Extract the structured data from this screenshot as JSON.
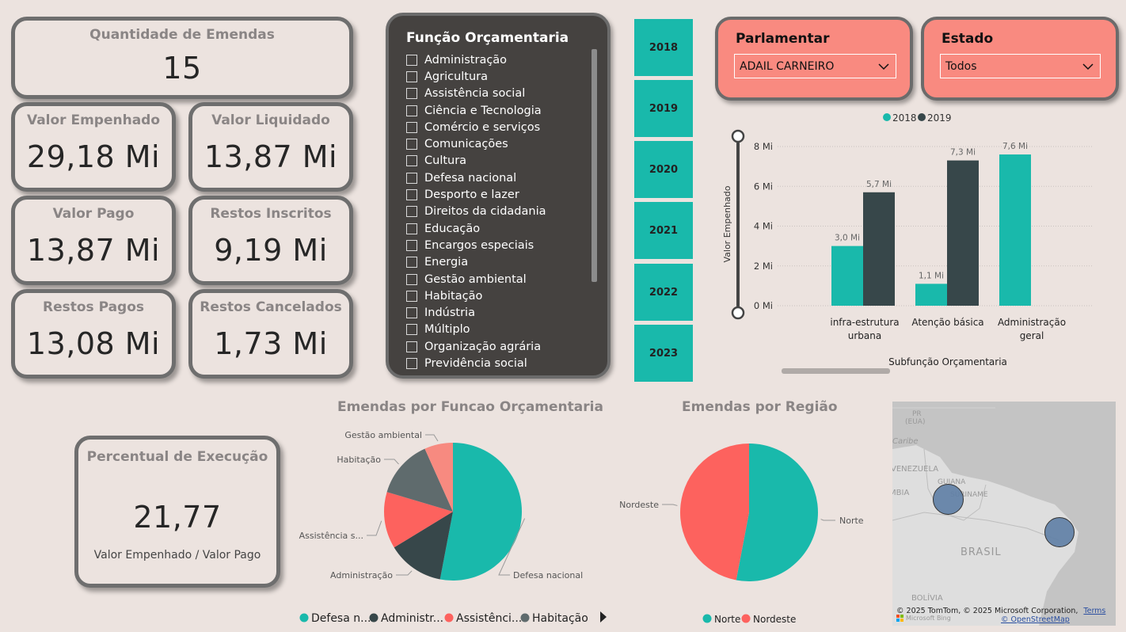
{
  "kpis": {
    "quantidade": {
      "label": "Quantidade de Emendas",
      "value": "15"
    },
    "empenhado": {
      "label": "Valor Empenhado",
      "value": "29,18 Mi"
    },
    "liquidado": {
      "label": "Valor Liquidado",
      "value": "13,87 Mi"
    },
    "pago": {
      "label": "Valor Pago",
      "value": "13,87 Mi"
    },
    "restos_inscritos": {
      "label": "Restos Inscritos",
      "value": "9,19 Mi"
    },
    "restos_pagos": {
      "label": "Restos Pagos",
      "value": "13,08 Mi"
    },
    "restos_cancelados": {
      "label": "Restos Cancelados",
      "value": "1,73 Mi"
    },
    "percentual": {
      "label": "Percentual de Execução",
      "value": "21,77",
      "sublabel": "Valor Empenhado / Valor Pago"
    }
  },
  "funcao_filter": {
    "title": "Função Orçamentaria",
    "items": [
      "Administração",
      "Agricultura",
      "Assistência social",
      "Ciência e Tecnologia",
      "Comércio e serviços",
      "Comunicações",
      "Cultura",
      "Defesa nacional",
      "Desporto e lazer",
      "Direitos da cidadania",
      "Educação",
      "Encargos especiais",
      "Energia",
      "Gestão ambiental",
      "Habitação",
      "Indústria",
      "Múltiplo",
      "Organização agrária",
      "Previdência social"
    ]
  },
  "years": [
    "2018",
    "2019",
    "2020",
    "2021",
    "2022",
    "2023"
  ],
  "parlamentar": {
    "label": "Parlamentar",
    "selected": "ADAIL CARNEIRO"
  },
  "estado": {
    "label": "Estado",
    "selected": "Todos"
  },
  "colors": {
    "teal": "#19b9ab",
    "dark": "#37474a",
    "coral": "#fd625e",
    "grey": "#5f6b6d",
    "pink": "#f78a80"
  },
  "chart_data": [
    {
      "type": "bar",
      "categories": [
        [
          "infra-estrutura",
          "urbana"
        ],
        [
          "Atenção básica"
        ],
        [
          "Administração",
          "geral"
        ]
      ],
      "series": [
        {
          "name": "2018",
          "color": "#19b9ab",
          "values": [
            3.0,
            1.1,
            7.6
          ],
          "labels": [
            "3,0 Mi",
            "1,1 Mi",
            "7,6 Mi"
          ]
        },
        {
          "name": "2019",
          "color": "#37474a",
          "values": [
            5.7,
            7.3,
            null
          ],
          "labels": [
            "5,7 Mi",
            "7,3 Mi",
            ""
          ]
        }
      ],
      "yticks": [
        "8 Mi",
        "6 Mi",
        "4 Mi",
        "2 Mi",
        "0 Mi"
      ],
      "ylim": [
        0,
        8
      ],
      "xlabel": "Subfunção Orçamentaria",
      "ylabel": "Valor Empenhado",
      "legend": "top"
    },
    {
      "type": "pie",
      "title": "Emendas por Funcao Orçamentaria",
      "slices": [
        {
          "name": "Defesa nacional",
          "label": "Defesa nacional",
          "value": 53,
          "color": "#19b9ab"
        },
        {
          "name": "Administração",
          "label": "Administração",
          "value": 13.3,
          "color": "#37474a"
        },
        {
          "name": "Assistência social",
          "label": "Assistência s...",
          "value": 13.3,
          "color": "#fd625e"
        },
        {
          "name": "Habitação",
          "label": "Habitação",
          "value": 13.7,
          "color": "#5f6b6d"
        },
        {
          "name": "Gestão ambiental",
          "label": "Gestão ambiental",
          "value": 6.7,
          "color": "#f78a80"
        }
      ],
      "legend_items": [
        "Defesa n...",
        "Administr...",
        "Assistênci...",
        "Habitação"
      ]
    },
    {
      "type": "pie",
      "title": "Emendas por Região",
      "slices": [
        {
          "name": "Norte",
          "label": "Norte",
          "value": 53,
          "color": "#19b9ab"
        },
        {
          "name": "Nordeste",
          "label": "Nordeste",
          "value": 47,
          "color": "#fd625e"
        }
      ],
      "legend_items": [
        "Norte",
        "Nordeste"
      ]
    }
  ],
  "map": {
    "labels": {
      "pr": "PR",
      "eua": "(EUA)",
      "caribe": "Caribe",
      "venezuela": "VENEZUELA",
      "mbia": "MBIA",
      "guiana": "GUIANA",
      "suriname": "SURINAME",
      "brasil": "BRASIL",
      "bolivia": "BOLÍVIA"
    },
    "copyright": "© 2025 TomTom, © 2025 Microsoft Corporation,",
    "terms": "Terms",
    "osm": "© OpenStreetMap",
    "bing": "Microsoft Bing"
  }
}
